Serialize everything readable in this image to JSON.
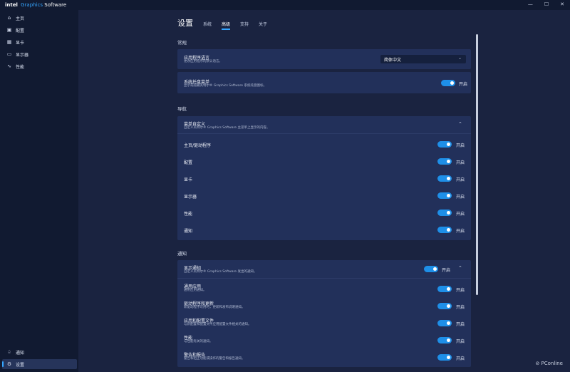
{
  "app": {
    "brand_intel": "intel",
    "brand_graphics": "Graphics",
    "brand_software": "Software",
    "window_controls": {
      "minimize": "—",
      "maximize": "☐",
      "close": "✕"
    }
  },
  "sidebar": {
    "items": [
      {
        "label": "主页",
        "icon": "⌂"
      },
      {
        "label": "配置",
        "icon": "▣"
      },
      {
        "label": "显卡",
        "icon": "▦"
      },
      {
        "label": "显示器",
        "icon": "▭"
      },
      {
        "label": "性能",
        "icon": "∿"
      }
    ],
    "bottom_items": [
      {
        "label": "通知",
        "icon": "♤"
      },
      {
        "label": "设置",
        "icon": "⚙"
      }
    ]
  },
  "header": {
    "title": "设置",
    "tabs": [
      "系统",
      "高级",
      "支持",
      "关于"
    ]
  },
  "sections": {
    "general": {
      "label": "常规",
      "language": {
        "title": "应用程序语言",
        "desc": "更改应用程序的默认语言。",
        "value": "简体中文"
      },
      "tray": {
        "title": "系统托盘菜单",
        "desc": "显示或隐藏英特尔® Graphics Software 系统托盘图标。",
        "state": "开启"
      }
    },
    "navigation": {
      "label": "导航",
      "header": {
        "title": "菜单自定义",
        "desc": "自定义英特尔® Graphics Software 主菜单上显示的内容。"
      },
      "items": [
        {
          "title": "主页/驱动程序",
          "state": "开启"
        },
        {
          "title": "配置",
          "state": "开启"
        },
        {
          "title": "显卡",
          "state": "开启"
        },
        {
          "title": "显示器",
          "state": "开启"
        },
        {
          "title": "性能",
          "state": "开启"
        },
        {
          "title": "通知",
          "state": "开启"
        }
      ]
    },
    "notifications": {
      "label": "通知",
      "header": {
        "title": "显示通知",
        "desc": "自定义英特尔® Graphics Software 发出的通知。",
        "state": "开启"
      },
      "items": [
        {
          "title": "通用应用",
          "desc": "通用应用通知。",
          "state": "开启"
        },
        {
          "title": "驱动程序和更新",
          "desc": "新驱动程序可用时，更新和发布说明通知。",
          "state": "开启"
        },
        {
          "title": "应用和配置文件",
          "desc": "与新配置和配置文件应用配置文件相关的通知。",
          "state": "开启"
        },
        {
          "title": "性能",
          "desc": "与性能有关的通知。",
          "state": "开启"
        },
        {
          "title": "警告和报告",
          "desc": "警告和阻止功能或操作的警告和报告通知。",
          "state": "开启"
        }
      ]
    }
  },
  "watermark": "PConline",
  "colors": {
    "accent": "#35a6ff",
    "toggle_on": "#1e8fe8",
    "card": "#22305a",
    "background": "#1a2340",
    "sidebar": "#111a31"
  }
}
